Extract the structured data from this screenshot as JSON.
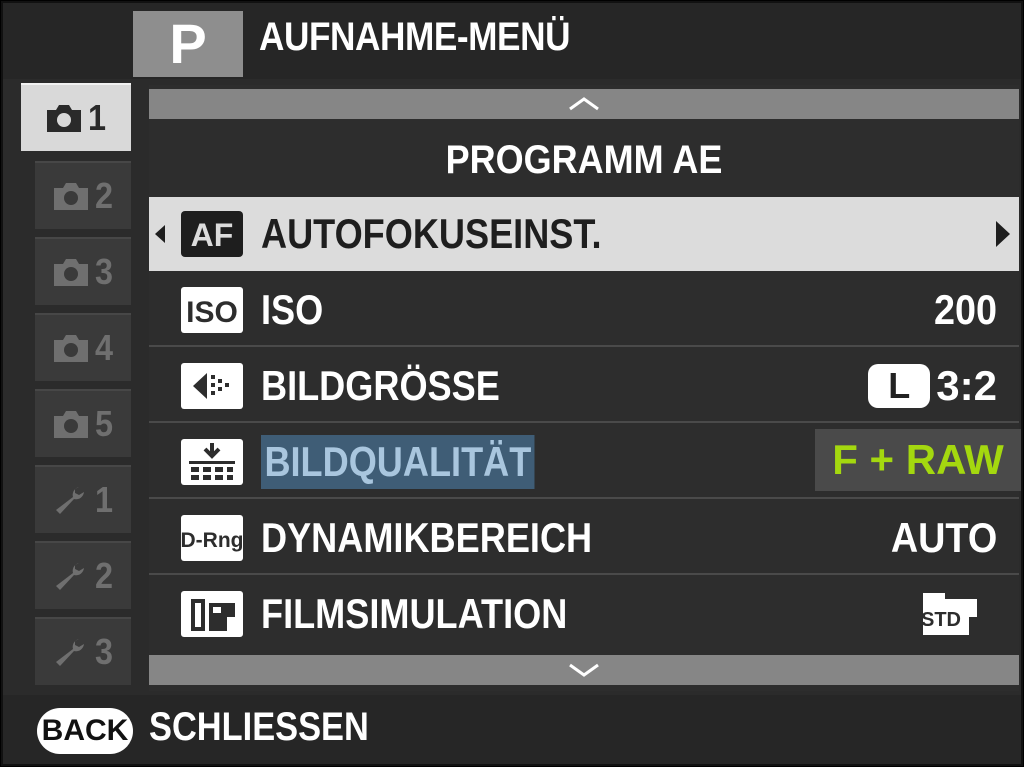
{
  "header": {
    "mode": "P",
    "title": "AUFNAHME-MENÜ"
  },
  "tabs": [
    {
      "icon": "camera-icon",
      "number": "1",
      "active": true
    },
    {
      "icon": "camera-icon",
      "number": "2",
      "active": false
    },
    {
      "icon": "camera-icon",
      "number": "3",
      "active": false
    },
    {
      "icon": "camera-icon",
      "number": "4",
      "active": false
    },
    {
      "icon": "camera-icon",
      "number": "5",
      "active": false
    },
    {
      "icon": "wrench-icon",
      "number": "1",
      "active": false
    },
    {
      "icon": "wrench-icon",
      "number": "2",
      "active": false
    },
    {
      "icon": "wrench-icon",
      "number": "3",
      "active": false
    }
  ],
  "menu": {
    "subtitle": "PROGRAMM AE",
    "items": [
      {
        "icon": "af-icon",
        "icon_text": "AF",
        "label": "AUTOFOKUSEINST.",
        "value": "",
        "selected": true
      },
      {
        "icon": "iso-icon",
        "icon_text": "ISO",
        "label": "ISO",
        "value": "200"
      },
      {
        "icon": "image-size-icon",
        "label": "BILDGRÖSSE",
        "value_badge": "L",
        "value": "3:2"
      },
      {
        "icon": "image-quality-icon",
        "label": "BILDQUALITÄT",
        "value": "F + RAW",
        "highlight_color": "#a4d80f"
      },
      {
        "icon": "dynamic-range-icon",
        "icon_text": "D-Rng",
        "label": "DYNAMIKBEREICH",
        "value": "AUTO"
      },
      {
        "icon": "film-simulation-icon",
        "label": "FILMSIMULATION",
        "value_icon": "std-film-icon",
        "value_icon_text": "STD"
      }
    ]
  },
  "footer": {
    "back_label": "BACK",
    "close_label": "SCHLIESSEN"
  }
}
